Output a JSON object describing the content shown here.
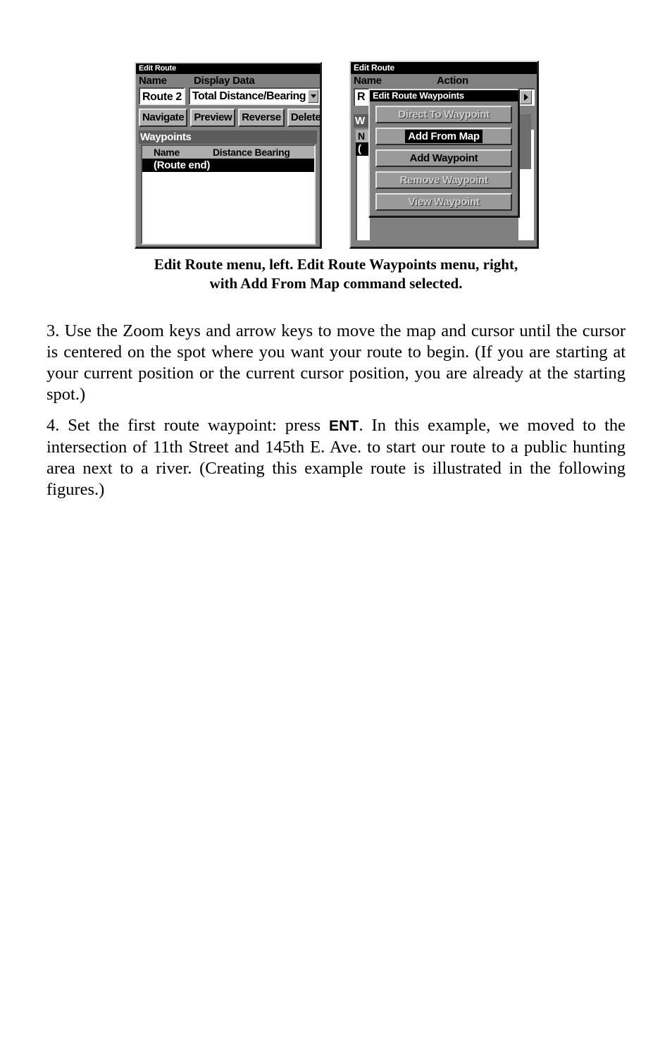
{
  "figure": {
    "left_panel": {
      "title": "Edit Route",
      "labels": {
        "name": "Name",
        "display_data": "Display Data"
      },
      "route_name_value": "Route 2",
      "display_data_value": "Total Distance/Bearing",
      "buttons": [
        "Navigate",
        "Preview",
        "Reverse",
        "Delete"
      ],
      "waypoints_header": "Waypoints",
      "list_columns": [
        "Name",
        "Distance Bearing"
      ],
      "list_rows": [
        "(Route end)"
      ]
    },
    "right_panel": {
      "title": "Edit Route",
      "labels": {
        "name": "Name",
        "action": "Action"
      },
      "background_remnants": {
        "route_name_value": "R",
        "waypoints_header": "W",
        "list_column_name": "N",
        "list_row": "("
      },
      "dialog": {
        "title": "Edit Route Waypoints",
        "buttons": [
          {
            "label": "Direct To Waypoint",
            "state": "disabled"
          },
          {
            "label": "Add From Map",
            "state": "selected"
          },
          {
            "label": "Add Waypoint",
            "state": "enabled"
          },
          {
            "label": "Remove Waypoint",
            "state": "disabled"
          },
          {
            "label": "View Waypoint",
            "state": "disabled"
          }
        ]
      }
    }
  },
  "caption": {
    "line1": "Edit Route menu, left. Edit Route Waypoints menu, right,",
    "line2": "with Add From Map command selected."
  },
  "paragraphs": {
    "step3": "3. Use the Zoom keys and arrow keys to move the map and cursor until the cursor is centered on the spot where you want your route to begin. (If you are starting at your current position or the current cursor position, you are already at the starting spot.)",
    "step4_before": "4. Set the first route waypoint: press ",
    "step4_key": "ENT",
    "step4_after": ". In this example, we moved to the intersection of 11th Street and 145th E. Ave. to start our route to a public hunting area next to a river. (Creating this example route is illustrated in the following figures.)"
  },
  "colors": {
    "panel_bg": "#808080",
    "title_bg": "#000000",
    "button_face": "#b0b0b0",
    "dialog_button_face": "#9a9a9a",
    "section_header_bg": "#5c5c5c",
    "list_header_bg": "#adadad",
    "selection_bg": "#000000",
    "field_bg": "#ffffff",
    "page_bg": "#ffffff",
    "text": "#000000"
  }
}
